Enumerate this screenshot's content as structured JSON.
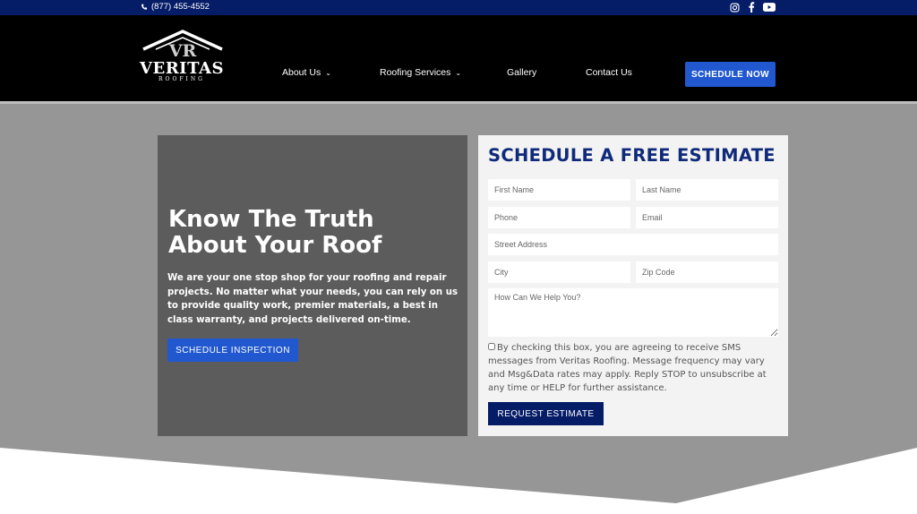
{
  "topbar": {
    "phone": "(877) 455-4552",
    "social": [
      "instagram-icon",
      "facebook-icon",
      "youtube-icon"
    ]
  },
  "header": {
    "logo": {
      "name": "VERITAS",
      "sub": "ROOFING",
      "mark": "VR"
    },
    "nav": [
      {
        "label": "About Us",
        "has_dropdown": true
      },
      {
        "label": "Roofing Services",
        "has_dropdown": true
      },
      {
        "label": "Gallery",
        "has_dropdown": false
      },
      {
        "label": "Contact Us",
        "has_dropdown": false
      }
    ],
    "cta": "SCHEDULE NOW"
  },
  "hero": {
    "title_line1": "Know The Truth",
    "title_line2": "About Your Roof",
    "text": "We are your one stop shop for your roofing and repair projects. No matter what your needs, you can rely on us to provide quality work, premier materials, a best in class warranty, and projects delivered on-time.",
    "button": "SCHEDULE INSPECTION"
  },
  "form": {
    "title": "SCHEDULE A FREE ESTIMATE",
    "placeholders": {
      "first_name": "First Name",
      "last_name": "Last Name",
      "phone": "Phone",
      "email": "Email",
      "street": "Street Address",
      "city": "City",
      "zip": "Zip Code",
      "message": "How Can We Help You?"
    },
    "consent": "By checking this box, you are agreeing to receive SMS messages from Veritas Roofing. Message frequency may vary and Msg&Data rates may apply. Reply STOP to unsubscribe at any time or HELP for further assistance.",
    "consent_checked": false,
    "submit": "REQUEST ESTIMATE"
  },
  "colors": {
    "topbar": "#051c67",
    "header": "#000000",
    "accent": "#2158cf",
    "hero_bg": "#969696",
    "hero_box": "#5c5c5c",
    "form_title": "#0f2a7a"
  }
}
